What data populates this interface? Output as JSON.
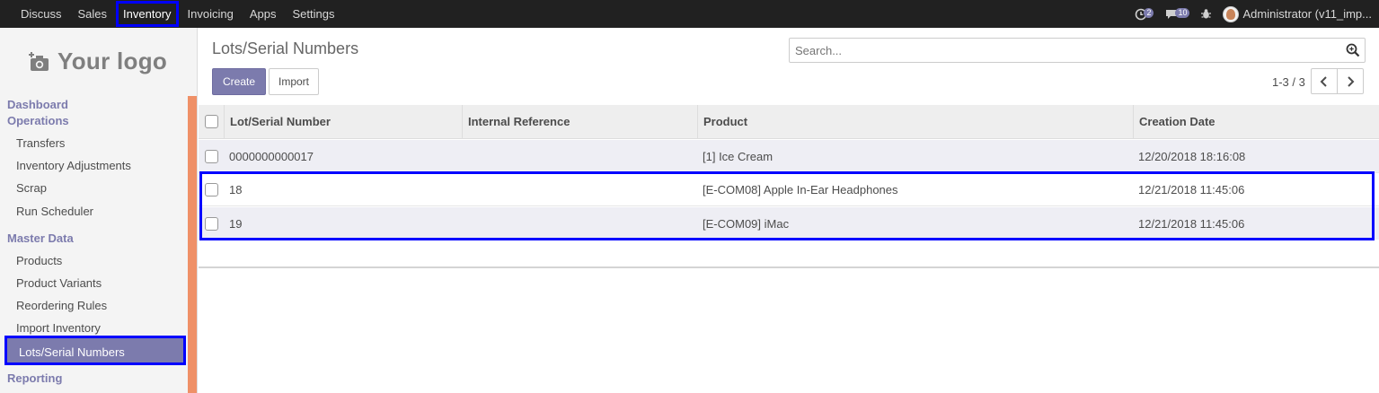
{
  "topbar": {
    "menu": [
      "Discuss",
      "Sales",
      "Inventory",
      "Invoicing",
      "Apps",
      "Settings"
    ],
    "active_menu": "Inventory",
    "activity_count": "2",
    "messages_count": "10",
    "user_name": "Administrator (v11_imp..."
  },
  "sidebar": {
    "logo_text": "Your logo",
    "headings": {
      "dashboard": "Dashboard",
      "operations": "Operations",
      "master_data": "Master Data",
      "reporting": "Reporting"
    },
    "operations_items": [
      "Transfers",
      "Inventory Adjustments",
      "Scrap",
      "Run Scheduler"
    ],
    "master_items": [
      "Products",
      "Product Variants",
      "Reordering Rules",
      "Import Inventory",
      "Lots/Serial Numbers"
    ],
    "active_item": "Lots/Serial Numbers"
  },
  "control_panel": {
    "breadcrumb": "Lots/Serial Numbers",
    "create_label": "Create",
    "import_label": "Import",
    "search_placeholder": "Search...",
    "pager": "1-3 / 3"
  },
  "table": {
    "columns": [
      "Lot/Serial Number",
      "Internal Reference",
      "Product",
      "Creation Date"
    ],
    "rows": [
      {
        "lot": "0000000000017",
        "ref": "",
        "product": "[1] Ice Cream",
        "date": "12/20/2018 18:16:08"
      },
      {
        "lot": "18",
        "ref": "",
        "product": "[E-COM08] Apple In-Ear Headphones",
        "date": "12/21/2018 11:45:06"
      },
      {
        "lot": "19",
        "ref": "",
        "product": "[E-COM09] iMac",
        "date": "12/21/2018 11:45:06"
      }
    ]
  },
  "colors": {
    "brand": "#7c7bad",
    "topbar_bg": "#212121",
    "sidebar_accent": "#ef9067",
    "highlight": "#0000ff"
  },
  "icons": {
    "logo": "camera-plus-icon",
    "activity": "clock-icon",
    "messages": "chat-bubble-icon",
    "debug": "bug-icon",
    "search": "magnifier-icon",
    "pager_prev": "chevron-left-icon",
    "pager_next": "chevron-right-icon"
  }
}
